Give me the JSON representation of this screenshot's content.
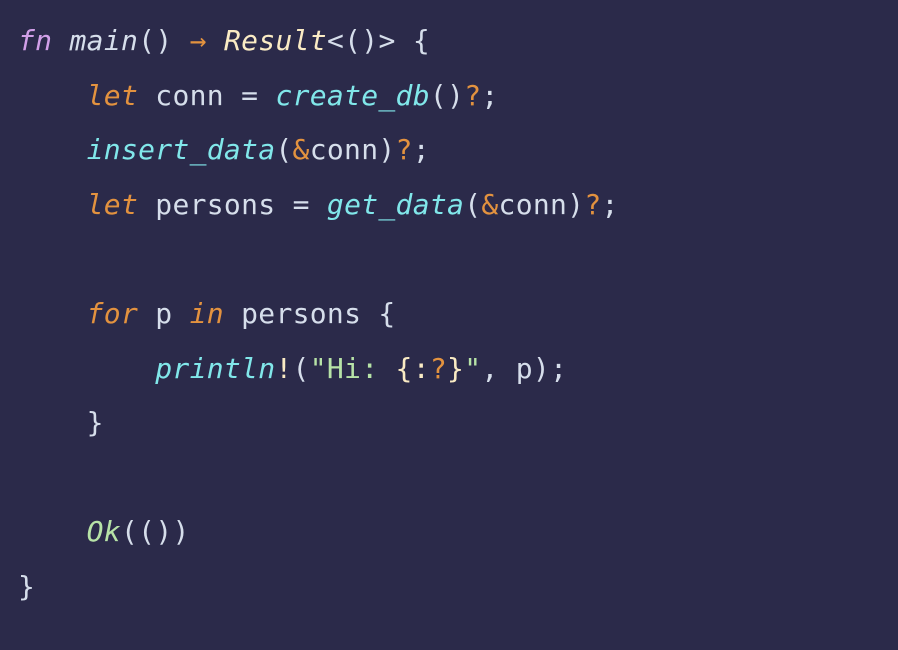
{
  "code": {
    "line1": {
      "fn": "fn",
      "name": "main",
      "lp1": "(",
      "rp1": ")",
      "arrow": "→",
      "result": "Result",
      "lt": "<",
      "lp2": "(",
      "rp2": ")",
      "gt": ">",
      "lb": "{"
    },
    "line2": {
      "indent": "    ",
      "let": "let",
      "var": "conn",
      "eq": "=",
      "call": "create_db",
      "lp": "(",
      "rp": ")",
      "q": "?",
      "semi": ";"
    },
    "line3": {
      "indent": "    ",
      "call": "insert_data",
      "lp": "(",
      "amp": "&",
      "arg": "conn",
      "rp": ")",
      "q": "?",
      "semi": ";"
    },
    "line4": {
      "indent": "    ",
      "let": "let",
      "var": "persons",
      "eq": "=",
      "call": "get_data",
      "lp": "(",
      "amp": "&",
      "arg": "conn",
      "rp": ")",
      "q": "?",
      "semi": ";"
    },
    "line6": {
      "indent": "    ",
      "for": "for",
      "var": "p",
      "in": "in",
      "iter": "persons",
      "lb": "{"
    },
    "line7": {
      "indent": "        ",
      "macro": "println",
      "bang": "!",
      "lp": "(",
      "s1": "\"Hi: ",
      "fmt_lb": "{",
      "fmt_colon": ":",
      "fmt_q": "?",
      "fmt_rb": "}",
      "s2": "\"",
      "comma": ",",
      "arg": "p",
      "rp": ")",
      "semi": ";"
    },
    "line8": {
      "indent": "    ",
      "rb": "}"
    },
    "line10": {
      "indent": "    ",
      "ok": "Ok",
      "lp1": "(",
      "lp2": "(",
      "rp2": ")",
      "rp1": ")"
    },
    "line11": {
      "rb": "}"
    }
  }
}
